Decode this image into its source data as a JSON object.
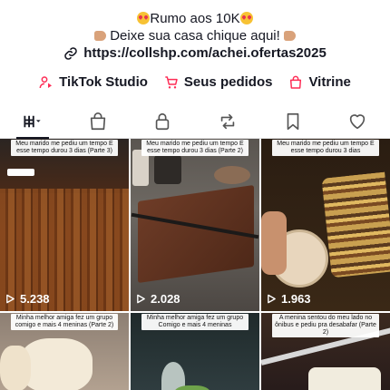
{
  "bio": {
    "line1": "Rumo aos 10K",
    "line2": "Deixe sua casa chique aqui!",
    "link": "https://collshp.com/achei.ofertas2025"
  },
  "actions": [
    {
      "label": "TikTok Studio",
      "icon": "tiktok-studio-icon"
    },
    {
      "label": "Seus pedidos",
      "icon": "cart-icon"
    },
    {
      "label": "Vitrine",
      "icon": "shopping-bag-icon"
    }
  ],
  "tabs": [
    {
      "icon": "grid-icon",
      "active": true
    },
    {
      "icon": "shop-bag-icon",
      "active": false
    },
    {
      "icon": "lock-icon",
      "active": false
    },
    {
      "icon": "repost-icon",
      "active": false
    },
    {
      "icon": "bookmark-icon",
      "active": false
    },
    {
      "icon": "heart-icon",
      "active": false
    }
  ],
  "videos": [
    {
      "caption": "Meu marido me pediu um tempo E esse tempo durou 3 dias (Parte 3)",
      "views": "5.238"
    },
    {
      "caption": "Meu marido me pediu um tempo E esse tempo durou 3 dias (Parte 2)",
      "views": "2.028"
    },
    {
      "caption": "Meu marido me pediu um tempo E esse tempo durou 3 dias",
      "views": "1.963"
    },
    {
      "caption": "Minha melhor amiga fez um grupo comigo e mais 4 meninas (Parte 2)",
      "views": ""
    },
    {
      "caption": "Minha melhor amiga fez um grupo Comigo e mais 4 meninas",
      "views": ""
    },
    {
      "caption": "A menina sentou do meu lado no ônibus e pediu pra desabafar (Parte 2)",
      "views": ""
    }
  ],
  "colors": {
    "text": "#161823",
    "accent": "#fe2c55",
    "divider": "#e3e3e4"
  }
}
